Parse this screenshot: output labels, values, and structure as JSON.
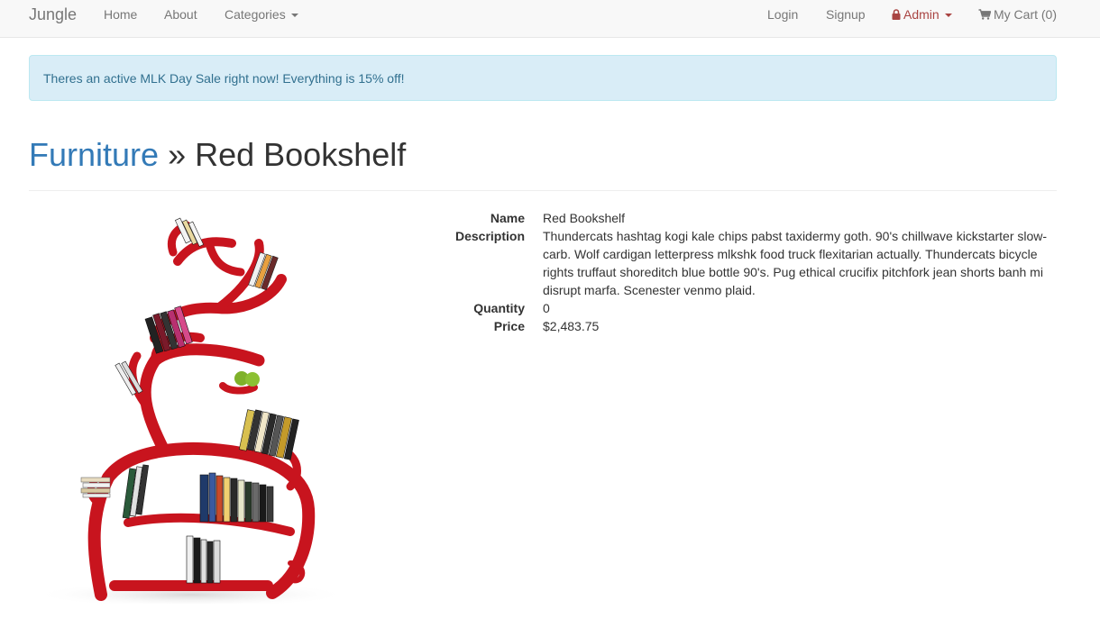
{
  "navbar": {
    "brand": "Jungle",
    "home": "Home",
    "about": "About",
    "categories": "Categories",
    "login": "Login",
    "signup": "Signup",
    "admin": "Admin",
    "cart": "My Cart (0)"
  },
  "alert": {
    "message": "Theres an active MLK Day Sale right now! Everything is 15% off!"
  },
  "header": {
    "category": "Furniture",
    "separator": " » ",
    "product": "Red Bookshelf"
  },
  "details": {
    "name_label": "Name",
    "name_value": "Red Bookshelf",
    "description_label": "Description",
    "description_value": "Thundercats hashtag kogi kale chips pabst taxidermy goth. 90's chillwave kickstarter slow-carb. Wolf cardigan letterpress mlkshk food truck flexitarian actually. Thundercats bicycle rights truffaut shoreditch blue bottle 90's. Pug ethical crucifix pitchfork jean shorts banh mi disrupt marfa. Scenester venmo plaid.",
    "quantity_label": "Quantity",
    "quantity_value": "0",
    "price_label": "Price",
    "price_value": "$2,483.75"
  },
  "colors": {
    "link": "#337ab7",
    "admin": "#a94442",
    "alert_bg": "#d9edf7",
    "alert_text": "#31708f",
    "shelf_red": "#c8141e"
  },
  "icons": {
    "admin": "lock-icon",
    "cart": "shopping-cart-icon",
    "dropdown": "caret-down-icon"
  }
}
